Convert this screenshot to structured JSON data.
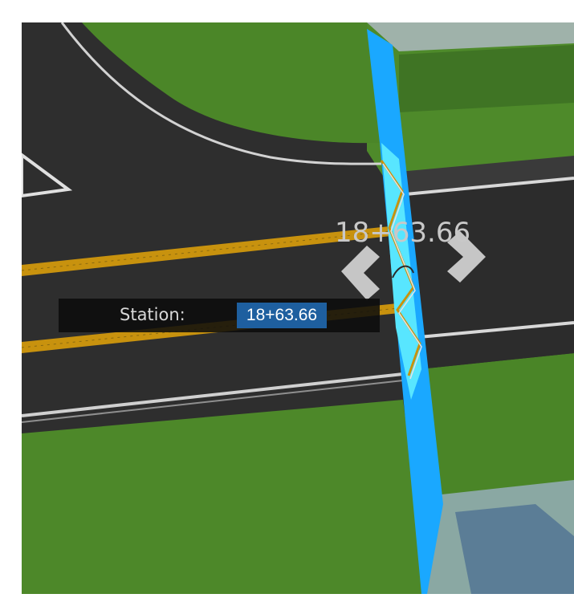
{
  "station_overlay": {
    "value": "18+63.66"
  },
  "station_editor": {
    "label": "Station:",
    "value": "18+63.66"
  },
  "icons": {
    "previous": "chevron-left-icon",
    "next": "chevron-right-icon"
  },
  "colors": {
    "asphalt": "#2f2f2f",
    "grass": "#4e8a2a",
    "centerline": "#c8920e",
    "lane_edge": "#cfcfcf",
    "section_plane": "#1aa8ff",
    "section_highlight": "#58e6ff",
    "input_highlight": "#1e5f9f"
  }
}
